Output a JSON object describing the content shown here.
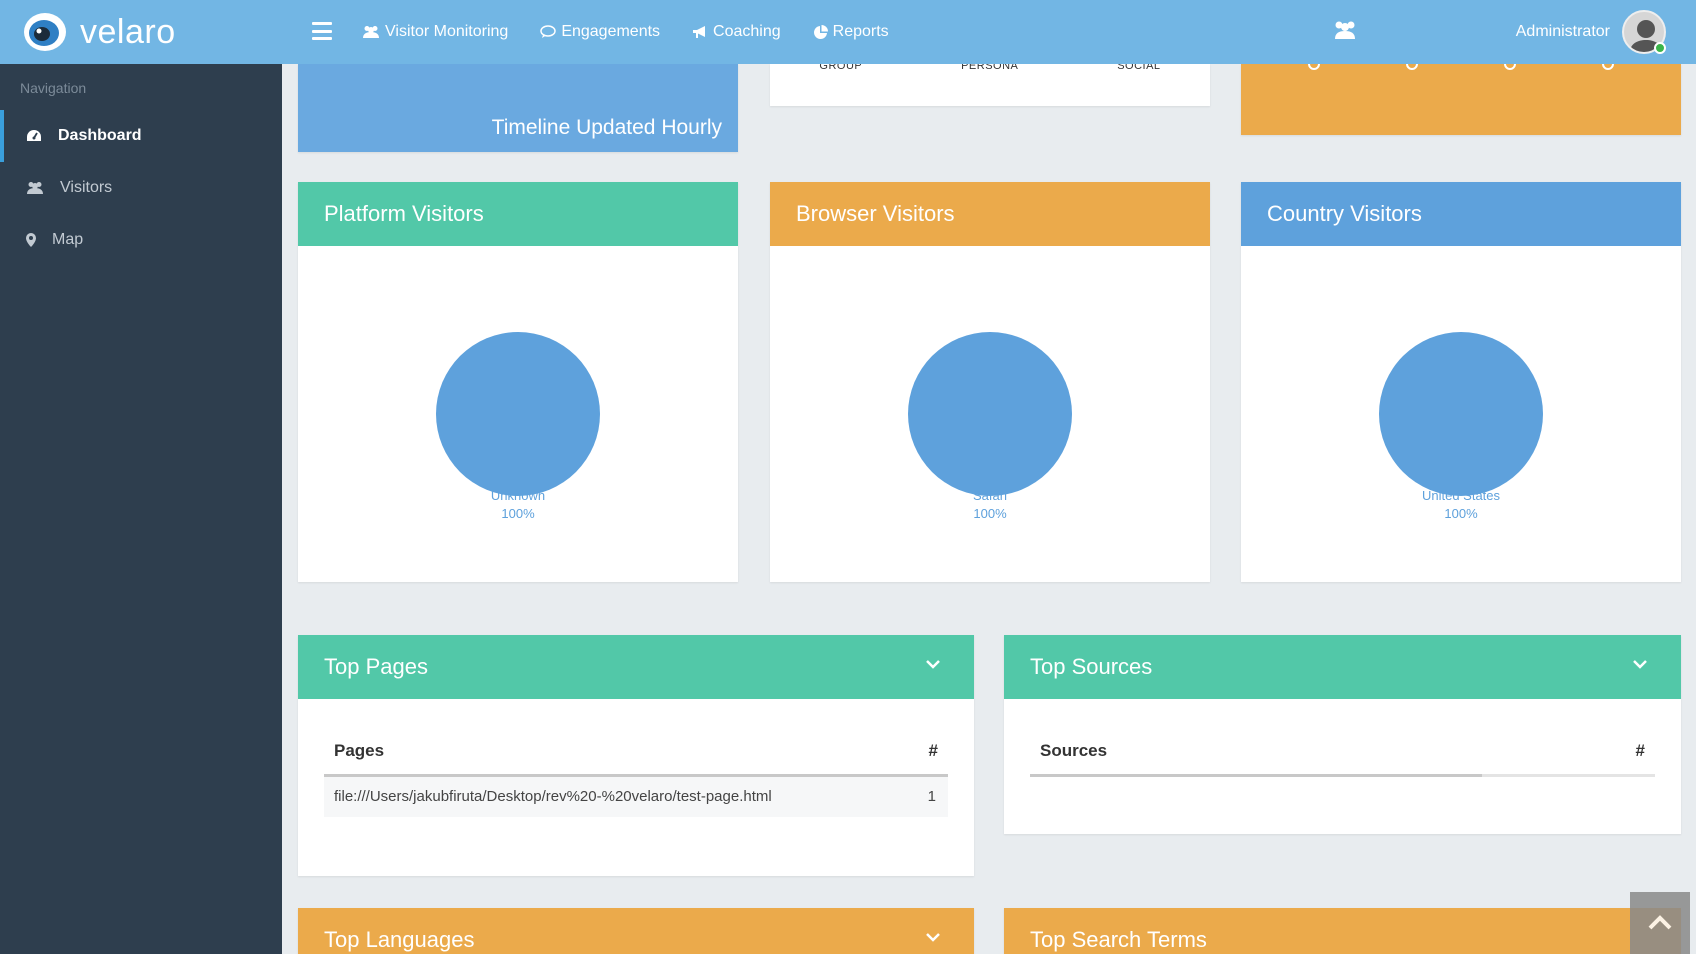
{
  "header": {
    "logo_text": "velaro",
    "menu": [
      {
        "label": "Visitor Monitoring",
        "icon": "users-icon"
      },
      {
        "label": "Engagements",
        "icon": "chat-bubble-icon"
      },
      {
        "label": "Coaching",
        "icon": "megaphone-icon"
      },
      {
        "label": "Reports",
        "icon": "pie-chart-icon"
      }
    ],
    "user_name": "Administrator"
  },
  "sidebar": {
    "heading": "Navigation",
    "items": [
      {
        "label": "Dashboard",
        "icon": "dashboard-gauge-icon",
        "active": true
      },
      {
        "label": "Visitors",
        "icon": "users-icon",
        "active": false
      },
      {
        "label": "Map",
        "icon": "map-marker-icon",
        "active": false
      }
    ]
  },
  "top_panels": {
    "timeline_caption": "Timeline Updated Hourly",
    "columns": [
      "GROUP",
      "PERSONA",
      "SOCIAL"
    ]
  },
  "pies": [
    {
      "title": "Platform Visitors",
      "label": "Unknown",
      "percent": "100%",
      "color": "#52c8a8"
    },
    {
      "title": "Browser Visitors",
      "label": "Safari",
      "percent": "100%",
      "color": "#ebaa4b"
    },
    {
      "title": "Country Visitors",
      "label": "United States",
      "percent": "100%",
      "color": "#5ea1dc"
    }
  ],
  "top_pages": {
    "title": "Top Pages",
    "col_label": "Pages",
    "col_count": "#",
    "rows": [
      {
        "page": "file:///Users/jakubfiruta/Desktop/rev%20-%20velaro/test-page.html",
        "count": "1"
      }
    ]
  },
  "top_sources": {
    "title": "Top Sources",
    "col_label": "Sources",
    "col_count": "#"
  },
  "bottom_panels": {
    "languages_title": "Top Languages",
    "search_terms_title": "Top Search Terms"
  },
  "colors": {
    "header": "#72b6e4",
    "sidebar": "#2e3e4e",
    "green": "#52c8a8",
    "orange": "#ebaa4b",
    "blue": "#5ea1dc"
  }
}
